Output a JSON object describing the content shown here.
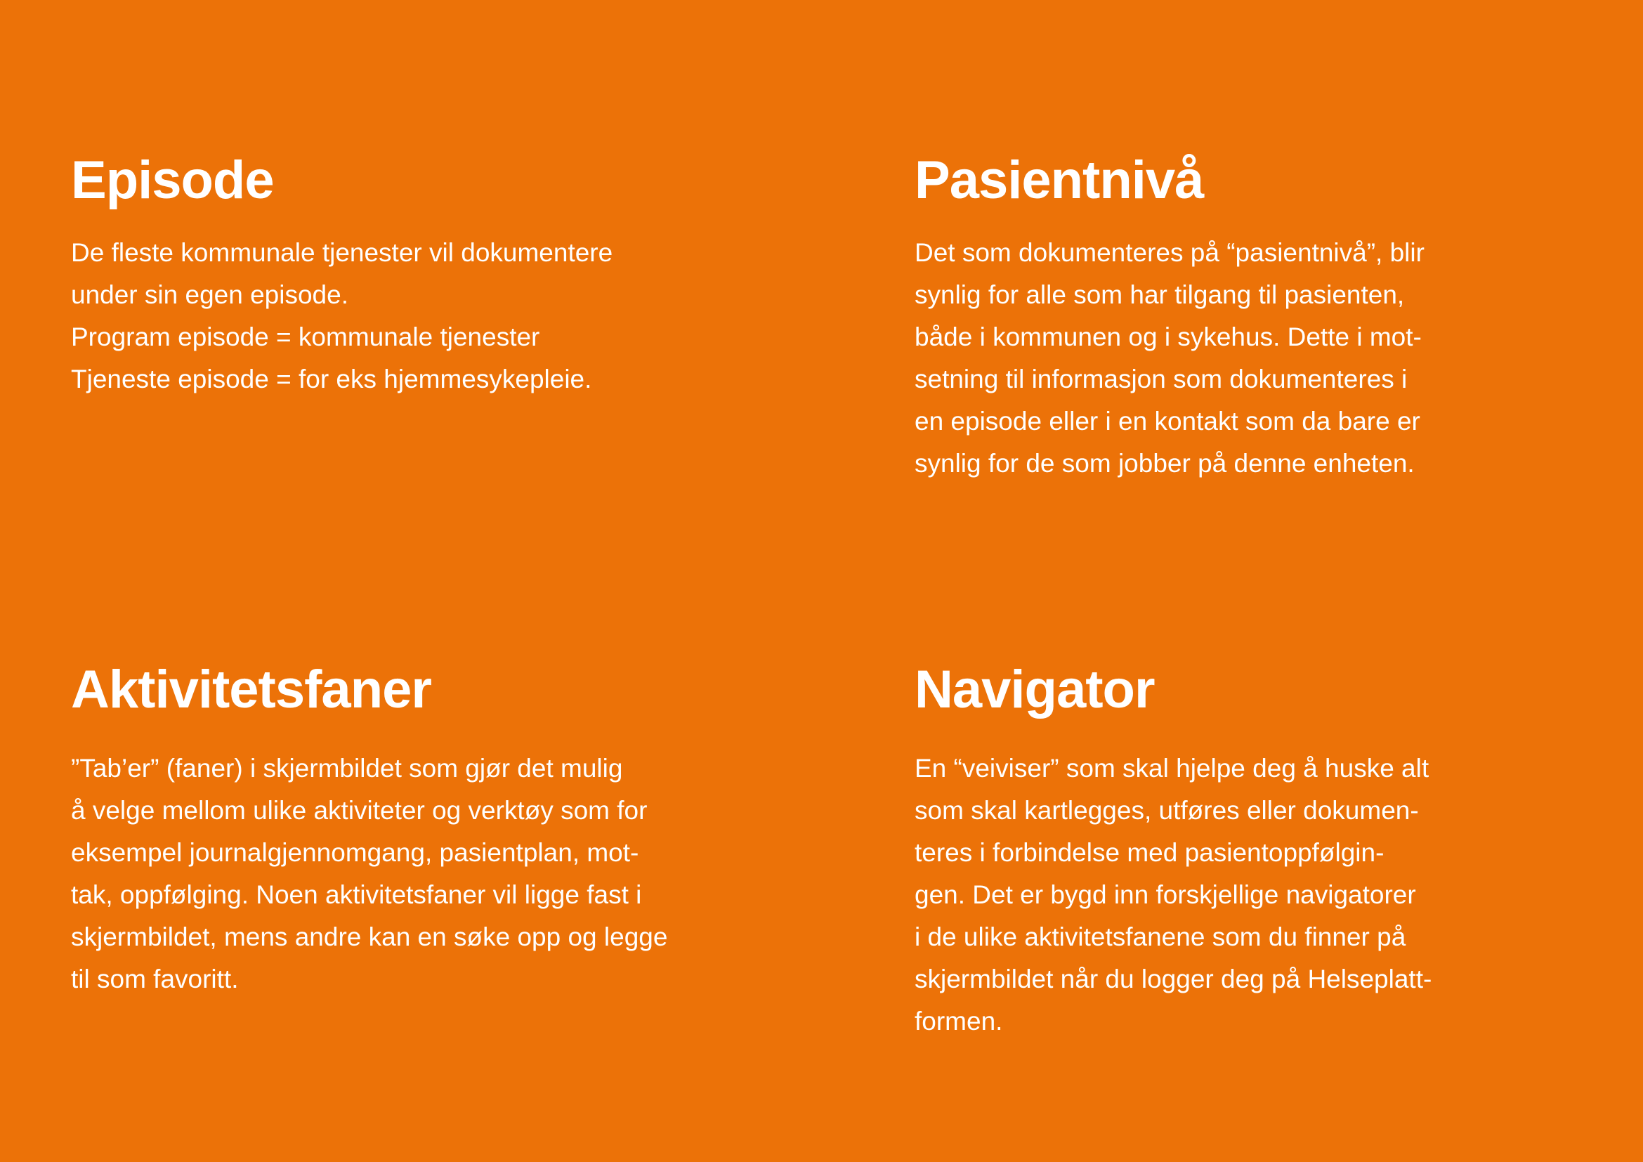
{
  "background_color": "#ec7208",
  "sections": [
    {
      "title": "Episode",
      "lines": [
        "De fleste kommunale tjenester vil dokumentere",
        "under sin egen episode.",
        "Program episode = kommunale tjenester",
        "Tjeneste episode = for eks hjemmesykepleie."
      ]
    },
    {
      "title": "Pasientnivå",
      "lines": [
        "Det som dokumenteres på “pasientnivå”, blir",
        "synlig for alle som har tilgang til pasienten,",
        "både i kommunen og i sykehus. Dette i mot-",
        "setning til informasjon som dokumenteres i",
        "en episode eller i en kontakt som da bare er",
        "synlig for de som jobber på denne enheten."
      ]
    },
    {
      "title": "Aktivitetsfaner",
      "lines": [
        "”Tab’er” (faner) i skjermbildet som gjør det mulig",
        "å velge mellom ulike aktiviteter og verktøy som for",
        "eksempel journalgjennomgang, pasientplan, mot-",
        "tak, oppfølging.  Noen aktivitetsfaner vil ligge fast i",
        "skjermbildet, mens andre kan en søke opp og legge",
        "til som favoritt."
      ]
    },
    {
      "title": "Navigator",
      "lines": [
        "En “veiviser” som  skal hjelpe deg å huske alt",
        "som skal kartlegges, utføres eller dokumen-",
        "teres i forbindelse med pasientoppfølgin-",
        "gen. Det er bygd inn forskjellige navigatorer",
        "i de ulike aktivitetsfanene som du finner på",
        "skjermbildet når du logger deg på Helseplatt-",
        "formen."
      ]
    }
  ]
}
